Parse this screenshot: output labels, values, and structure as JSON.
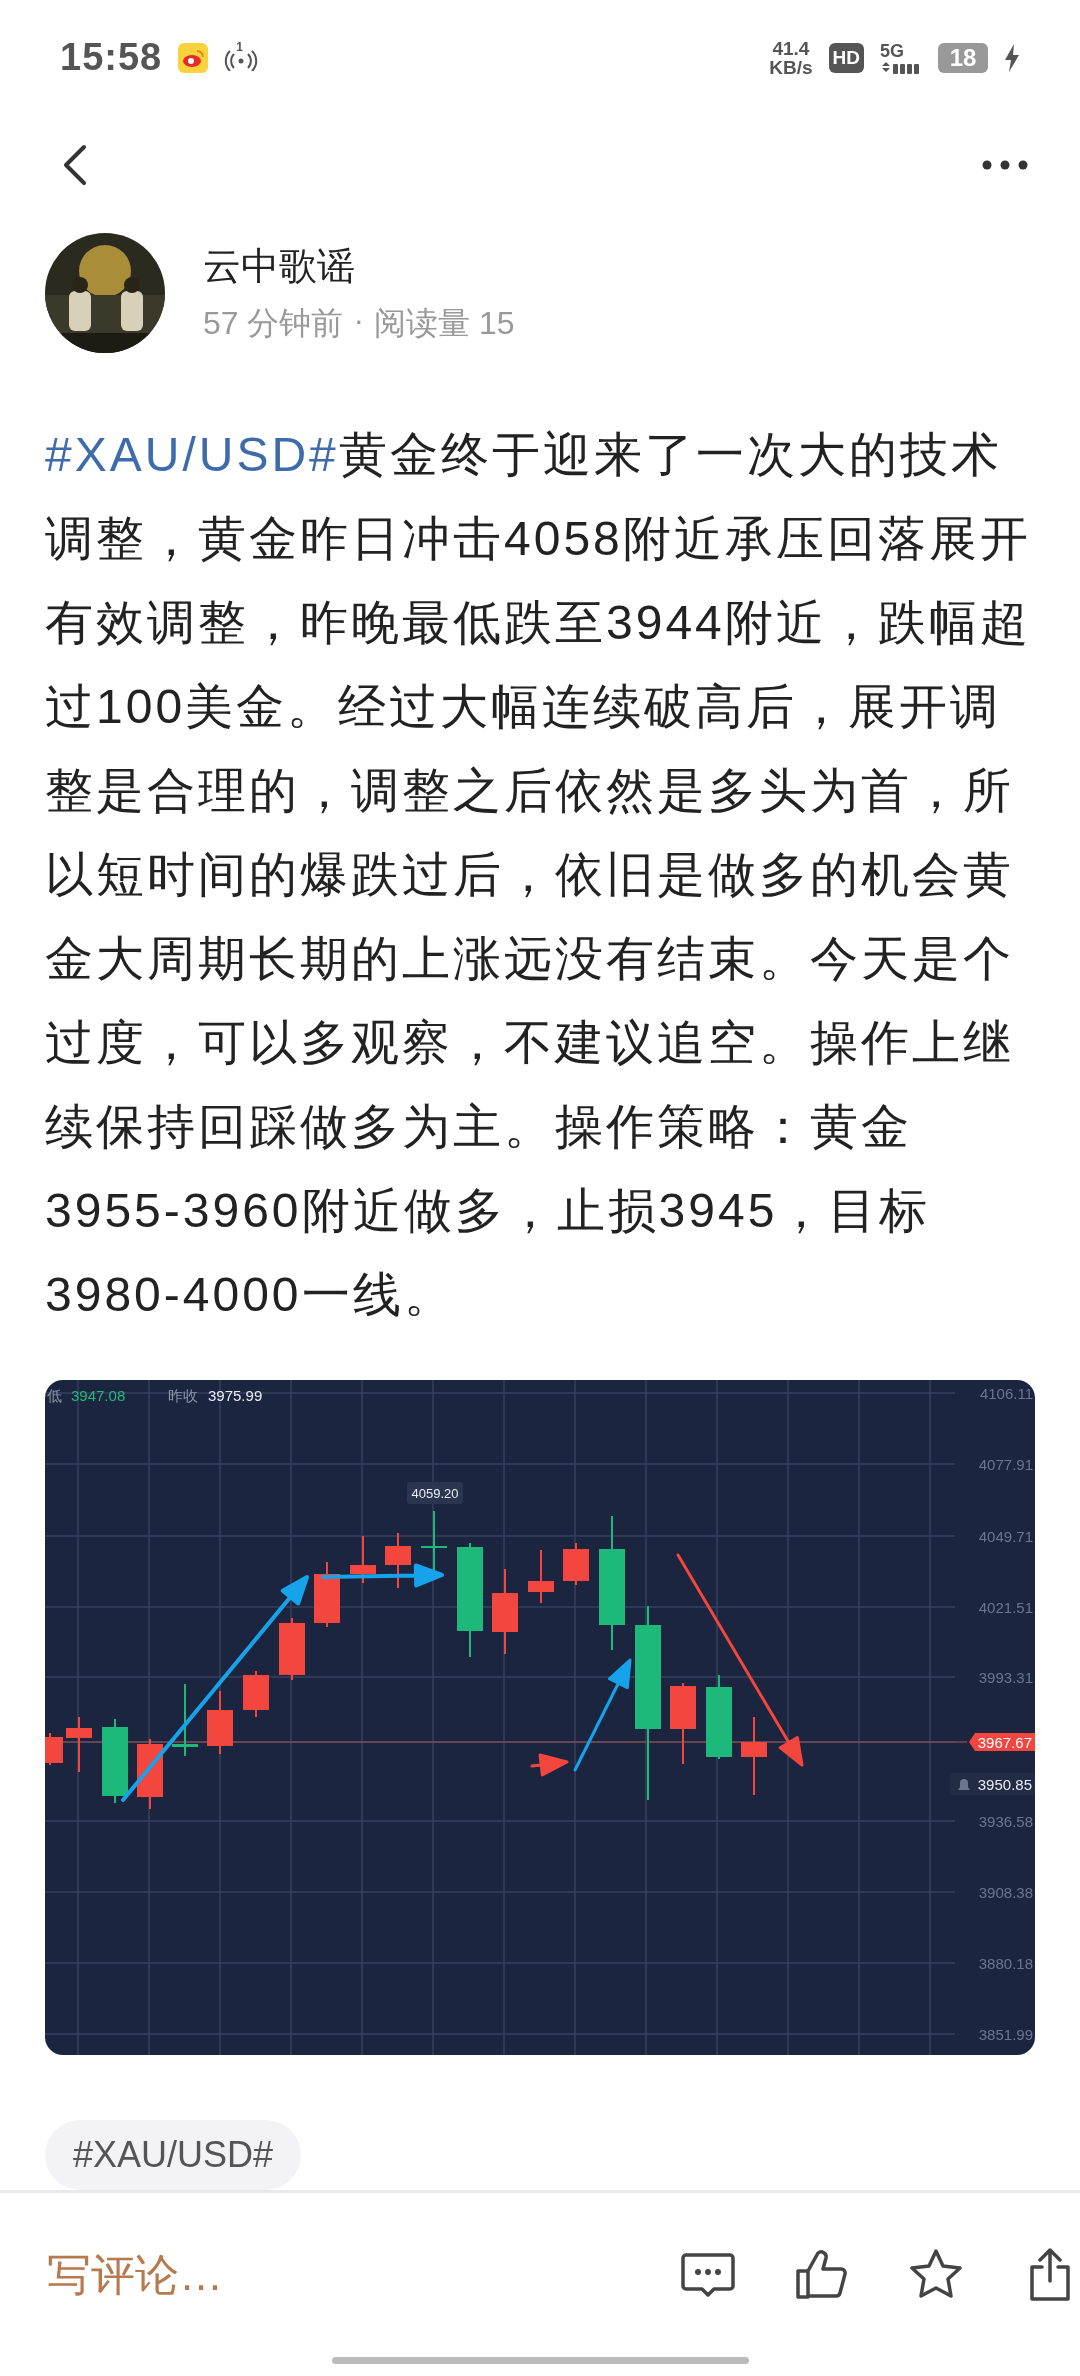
{
  "status_bar": {
    "time": "15:58",
    "hotspot_count": "1",
    "net_speed": "41.4",
    "net_unit": "KB/s",
    "hd": "HD",
    "network": "5G",
    "battery": "18"
  },
  "post": {
    "author": "云中歌谣",
    "time": "57 分钟前",
    "separator": "·",
    "views": "阅读量 15",
    "hashtag": "#XAU/USD#",
    "text": "黄金终于迎来了一次大的技术调整，黄金昨日冲击4058附近承压回落展开有效调整，昨晚最低跌至3944附近，跌幅超过100美金。经过大幅连续破高后，展开调整是合理的，调整之后依然是多头为首，所以短时间的爆跌过后，依旧是做多的机会黄金大周期长期的上涨远没有结束。今天是个过度，可以多观察，不建议追空。操作上继续保持回踩做多为主。操作策略：黄金3955-3960附近做多，止损3945，目标3980-4000一线。"
  },
  "chart": {
    "header": [
      {
        "label": "低",
        "value": "3947.08",
        "kind": "down"
      },
      {
        "label": "昨收",
        "value": "3975.99",
        "kind": "flat"
      }
    ],
    "peak_label": "4059.20",
    "price_axis": [
      "4106.11",
      "4077.91",
      "4049.71",
      "4021.51",
      "3993.31",
      "3936.58",
      "3908.38",
      "3880.18",
      "3851.99"
    ],
    "last_price": "3967.67",
    "alert_price": "3950.85"
  },
  "tags": [
    "#XAU/USD#"
  ],
  "comment_bar": {
    "placeholder": "写评论…"
  }
}
